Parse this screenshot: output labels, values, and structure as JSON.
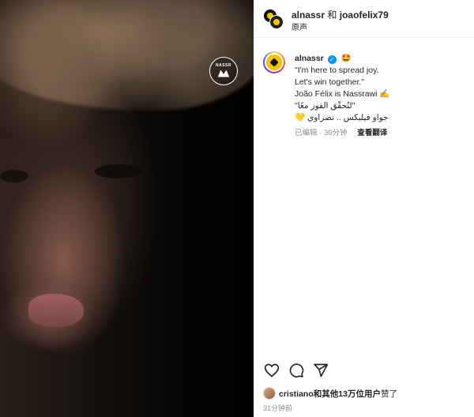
{
  "media": {
    "watermark_text": "NASSR"
  },
  "header": {
    "user1": "alnassr",
    "conjunction": "和",
    "user2": "joaofelix79",
    "audio_label": "原声"
  },
  "caption": {
    "username": "alnassr",
    "verified_mark": "✓",
    "emoji": "🤩",
    "line1": "\"I'm here to spread joy.",
    "line2": "Let's win together.\"",
    "line3": "João Félix is Nassrawi ✍️",
    "line4": "\"لنُحقّق الفوز معًا\"",
    "line5": "جواو فيليكس .. نصراوي 💛",
    "edited": "已编辑",
    "separator": " · ",
    "time_ago": "30分钟",
    "translate": "查看翻译"
  },
  "actions": {
    "like_icon": "heart-icon",
    "comment_icon": "comment-icon",
    "share_icon": "share-icon"
  },
  "likes": {
    "user": "cristiano",
    "rest_prefix": "和其他",
    "count": "13万位用户",
    "suffix": "赞了"
  },
  "timestamp": "31分钟前"
}
